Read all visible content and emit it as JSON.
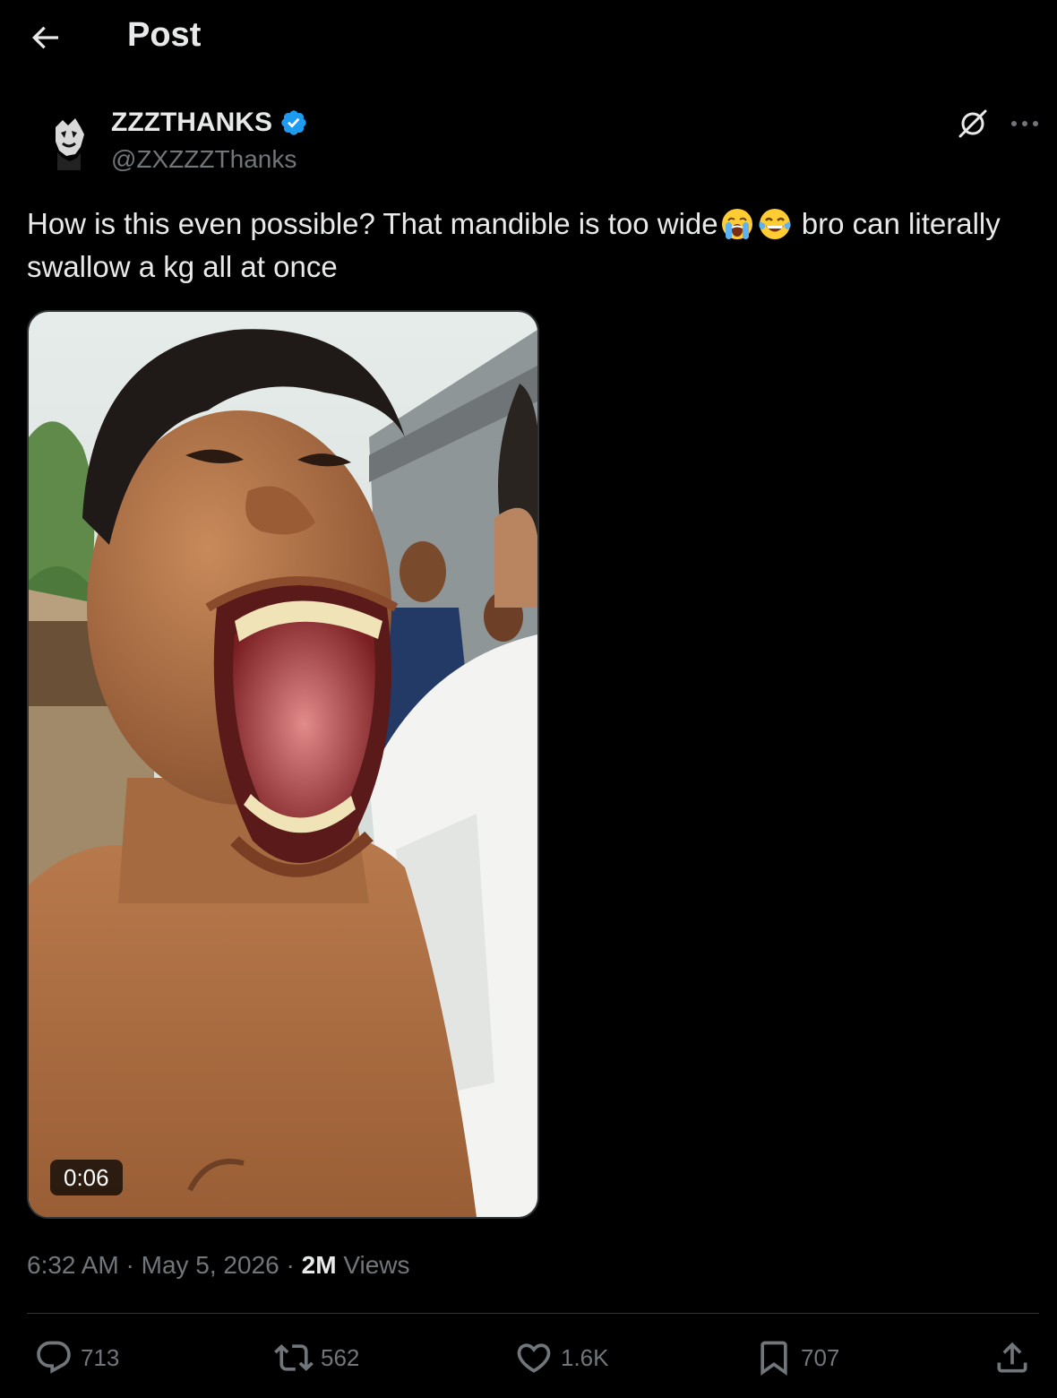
{
  "header": {
    "title": "Post"
  },
  "author": {
    "name": "ZZZTHANKS",
    "handle": "@ZXZZZThanks",
    "verified_color": "#1d9bf0"
  },
  "post": {
    "text_part1": "How is this even possible? That mandible is too wide",
    "emoji_1": "loudly-crying-face",
    "emoji_2": "face-with-tears-of-joy",
    "text_part2": " bro can literally swallow a kg all at once"
  },
  "media": {
    "type": "video",
    "duration": "0:06"
  },
  "meta": {
    "time": "6:32 AM",
    "separator": "·",
    "date": "May 5, 2026",
    "views_count": "2M",
    "views_label": "Views"
  },
  "actions": {
    "replies": "713",
    "reposts": "562",
    "likes": "1.6K",
    "bookmarks": "707"
  },
  "colors": {
    "background": "#000000",
    "text_primary": "#e7e9ea",
    "text_secondary": "#71767b",
    "divider": "#2f3336",
    "accent": "#1d9bf0"
  }
}
